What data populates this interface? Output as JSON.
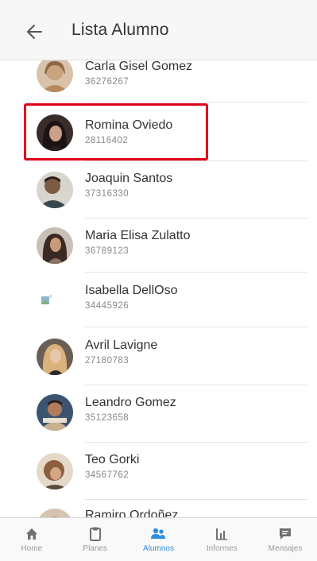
{
  "header": {
    "title": "Lista Alumno"
  },
  "students": [
    {
      "name": "Carla Gisel Gomez",
      "dni": "36276267",
      "avatar_color": "#c9a27e"
    },
    {
      "name": "Romina Oviedo",
      "dni": "28116402",
      "avatar_color": "#2a2020"
    },
    {
      "name": "Joaquin Santos",
      "dni": "37316330",
      "avatar_color": "#5a4636"
    },
    {
      "name": "Maria Elisa Zulatto",
      "dni": "36789123",
      "avatar_color": "#3b2a24"
    },
    {
      "name": "Isabella DellOso",
      "dni": "34445926",
      "avatar_color": "#8fb3c8"
    },
    {
      "name": "Avril Lavigne",
      "dni": "27180783",
      "avatar_color": "#cfa774"
    },
    {
      "name": "Leandro Gomez",
      "dni": "35123658",
      "avatar_color": "#6b4a3a"
    },
    {
      "name": "Teo Gorki",
      "dni": "34567762",
      "avatar_color": "#8a6040"
    },
    {
      "name": "Ramiro Ordoñez",
      "dni": "",
      "avatar_color": "#b48b6a"
    }
  ],
  "tabs": [
    {
      "label": "Home",
      "icon": "home-icon",
      "active": false
    },
    {
      "label": "Planes",
      "icon": "clipboard-icon",
      "active": false
    },
    {
      "label": "Alumnos",
      "icon": "people-icon",
      "active": true
    },
    {
      "label": "Informes",
      "icon": "bar-chart-icon",
      "active": false
    },
    {
      "label": "Mensajes",
      "icon": "message-icon",
      "active": false
    }
  ],
  "colors": {
    "accent": "#2f8ee0",
    "highlight": "#e0001b",
    "inactive": "#7a7a7a"
  }
}
